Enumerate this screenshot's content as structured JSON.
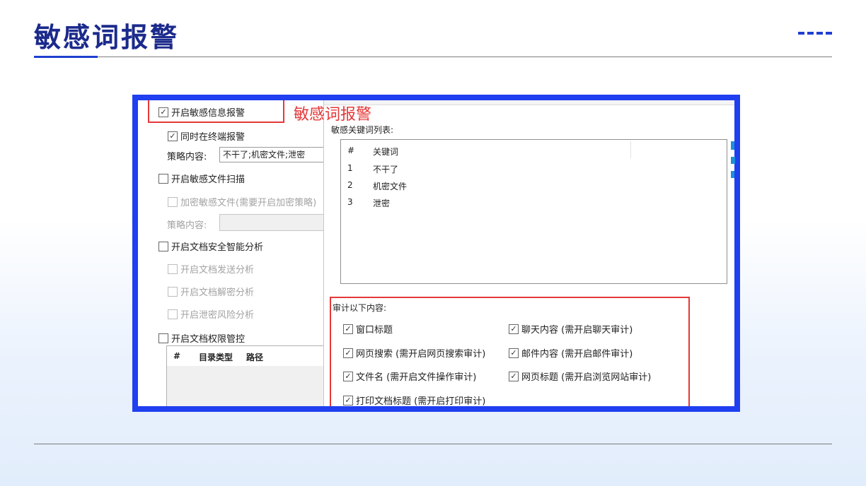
{
  "page": {
    "title": "敏感词报警",
    "annotation": "敏感词报警"
  },
  "left_panel": {
    "enable_alert": "开启敏感信息报警",
    "sync_terminal_alert": "同时在终端报警",
    "policy_label": "策略内容:",
    "policy_value": "不干了;机密文件;泄密",
    "enable_file_scan": "开启敏感文件扫描",
    "encrypt_files": "加密敏感文件(需要开启加密策略)",
    "policy_label_2": "策略内容:",
    "enable_doc_analysis": "开启文档安全智能分析",
    "doc_send_analysis": "开启文档发送分析",
    "doc_decrypt_analysis": "开启文档解密分析",
    "leak_risk_analysis": "开启泄密风险分析",
    "enable_doc_permission": "开启文档权限管控",
    "table_headers": [
      "#",
      "目录类型",
      "路径"
    ]
  },
  "right_panel": {
    "keyword_list_label": "敏感关键词列表:",
    "headers": [
      "#",
      "关键词"
    ],
    "rows": [
      {
        "num": "1",
        "keyword": "不干了"
      },
      {
        "num": "2",
        "keyword": "机密文件"
      },
      {
        "num": "3",
        "keyword": "泄密"
      }
    ],
    "audit_label": "审计以下内容:",
    "audit_items": [
      "窗口标题",
      "聊天内容 (需开启聊天审计)",
      "网页搜索 (需开启网页搜索审计)",
      "邮件内容 (需开启邮件审计)",
      "文件名 (需开启文件操作审计)",
      "网页标题 (需开启浏览网站审计)",
      "打印文档标题 (需开启打印审计)"
    ]
  },
  "colors": {
    "title": "#1b2a8c",
    "frame": "#1f3ff0",
    "annotation": "#e53838"
  }
}
